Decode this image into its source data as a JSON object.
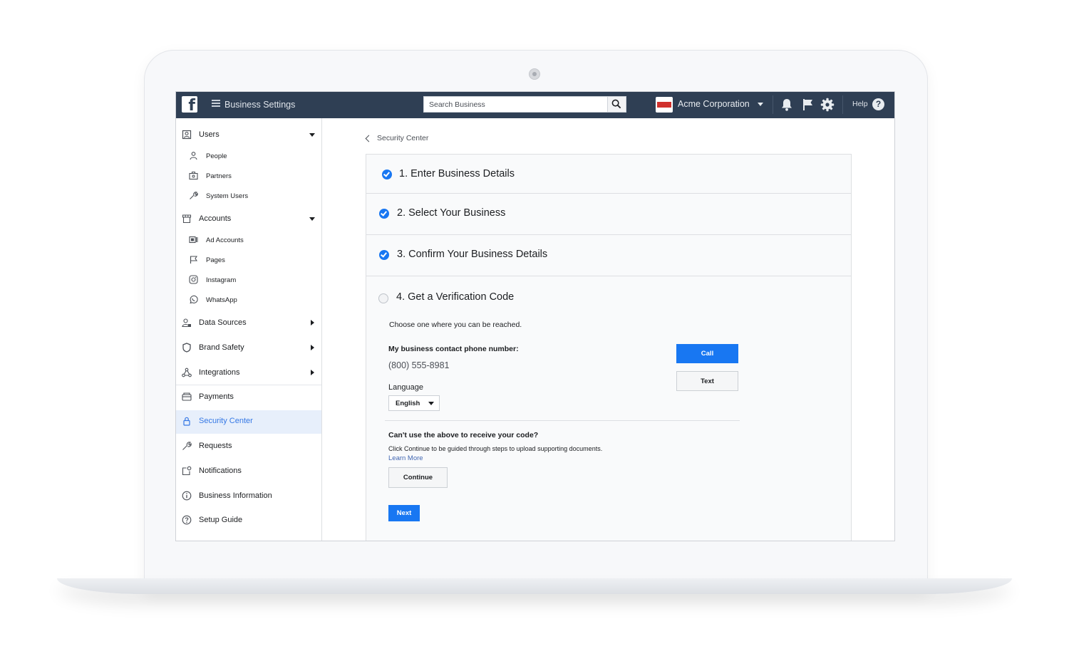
{
  "topbar": {
    "app_title": "Business Settings",
    "search_placeholder": "Search Business",
    "business_name": "Acme Corporation",
    "help_label": "Help",
    "help_glyph": "?",
    "brand_color": "#2f3f54",
    "icons": [
      "facebook-logo-icon",
      "menu-icon",
      "search-icon",
      "bell-icon",
      "flag-icon",
      "gear-icon",
      "help-icon"
    ]
  },
  "sidebar": {
    "users": {
      "label": "Users",
      "icon": "users-icon",
      "children": [
        {
          "label": "People",
          "icon": "person-icon"
        },
        {
          "label": "Partners",
          "icon": "briefcase-icon"
        },
        {
          "label": "System Users",
          "icon": "wrench-icon"
        }
      ]
    },
    "accounts": {
      "label": "Accounts",
      "icon": "storefront-icon",
      "children": [
        {
          "label": "Ad Accounts",
          "icon": "ad-account-icon"
        },
        {
          "label": "Pages",
          "icon": "flag-icon"
        },
        {
          "label": "Instagram",
          "icon": "instagram-icon"
        },
        {
          "label": "WhatsApp",
          "icon": "whatsapp-icon"
        }
      ]
    },
    "data_sources": {
      "label": "Data Sources",
      "icon": "data-sources-icon"
    },
    "brand_safety": {
      "label": "Brand Safety",
      "icon": "shield-icon"
    },
    "integrations": {
      "label": "Integrations",
      "icon": "integrations-icon"
    },
    "payments": {
      "label": "Payments",
      "icon": "payments-icon"
    },
    "security_center": {
      "label": "Security Center",
      "icon": "lock-icon",
      "active": true
    },
    "requests": {
      "label": "Requests",
      "icon": "wrench-icon"
    },
    "notifications": {
      "label": "Notifications",
      "icon": "notifications-icon"
    },
    "business_information": {
      "label": "Business Information",
      "icon": "info-icon"
    },
    "setup_guide": {
      "label": "Setup Guide",
      "icon": "question-icon"
    }
  },
  "main": {
    "breadcrumb": "Security Center",
    "steps": [
      {
        "label": "1. Enter Business Details",
        "done": true
      },
      {
        "label": "2. Select Your Business",
        "done": true
      },
      {
        "label": "3. Confirm Your Business Details",
        "done": true
      },
      {
        "label": "4. Get a Verification Code",
        "done": false
      }
    ],
    "verification": {
      "instruction": "Choose one where you can be reached.",
      "phone_label": "My business contact phone number:",
      "phone": "(800) 555-8981",
      "language_label": "Language",
      "language_value": "English",
      "call_label": "Call",
      "text_label": "Text",
      "alt_title": "Can't use the above to receive your code?",
      "alt_desc": "Click Continue to be guided through steps to upload supporting documents.",
      "learn_more": "Learn More",
      "continue_label": "Continue",
      "next_label": "Next"
    }
  },
  "colors": {
    "accent": "#1877f2",
    "active_bg": "#e7effb",
    "link": "#4267b2"
  }
}
